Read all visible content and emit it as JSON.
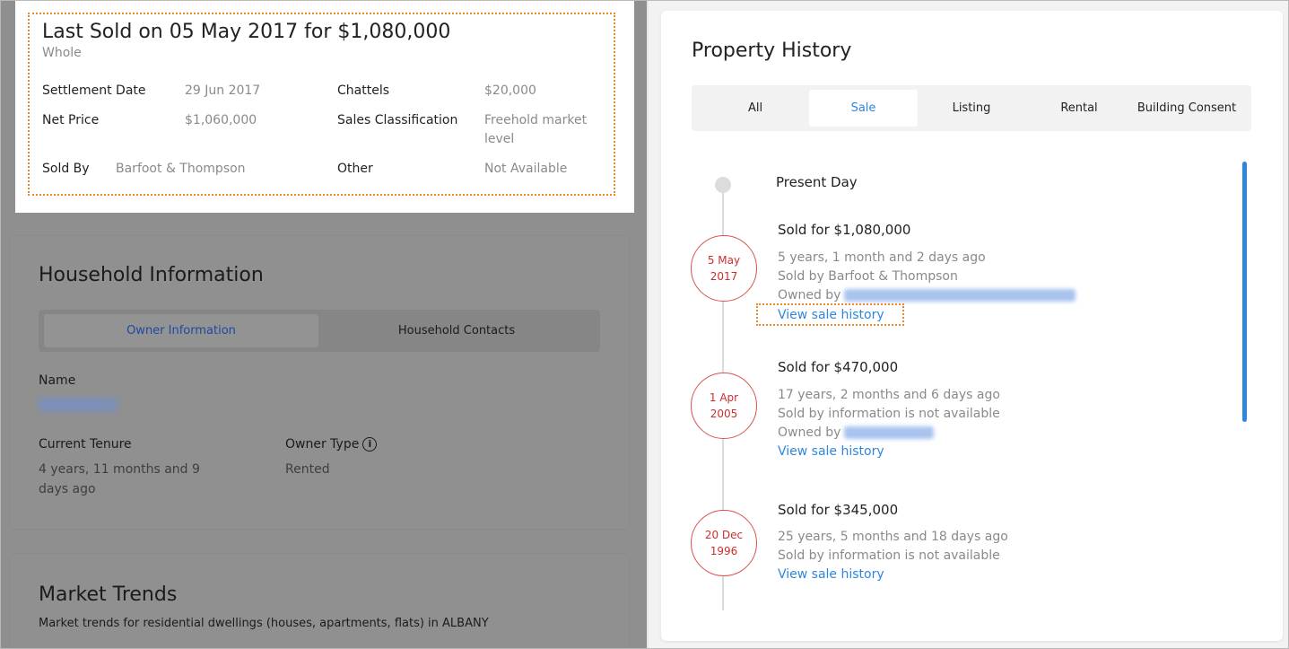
{
  "last_sold": {
    "title": "Last Sold on 05 May 2017 for $1,080,000",
    "subtitle": "Whole",
    "settlement_date_label": "Settlement Date",
    "settlement_date_value": "29 Jun 2017",
    "chattels_label": "Chattels",
    "chattels_value": "$20,000",
    "net_price_label": "Net Price",
    "net_price_value": "$1,060,000",
    "sales_class_label": "Sales Classification",
    "sales_class_value_1": "Freehold market",
    "sales_class_value_2": "level",
    "sold_by_label": "Sold By",
    "sold_by_value": "Barfoot & Thompson",
    "other_label": "Other",
    "other_value": "Not Available"
  },
  "household": {
    "title": "Household Information",
    "tab_owner": "Owner Information",
    "tab_contacts": "Household Contacts",
    "name_label": "Name",
    "tenure_label": "Current Tenure",
    "tenure_value_1": "4 years, 11 months and 9",
    "tenure_value_2": "days ago",
    "owner_type_label": "Owner Type",
    "owner_type_value": "Rented",
    "info_glyph": "i"
  },
  "market": {
    "title": "Market Trends",
    "subtitle": "Market trends for residential dwellings (houses, apartments, flats) in ALBANY"
  },
  "history": {
    "title": "Property History",
    "tabs": [
      "All",
      "Sale",
      "Listing",
      "Rental",
      "Building Consent"
    ],
    "active_tab": "Sale",
    "present_label": "Present Day",
    "sales": [
      {
        "date_line1": "5 May",
        "date_line2": "2017",
        "title": "Sold for $1,080,000",
        "ago": "5 years, 1 month and 2 days ago",
        "sold_by": "Sold by Barfoot & Thompson",
        "owned_by": "Owned by",
        "link": "View sale history"
      },
      {
        "date_line1": "1 Apr",
        "date_line2": "2005",
        "title": "Sold for $470,000",
        "ago": "17 years, 2 months and 6 days ago",
        "sold_by": "Sold by information is not available",
        "owned_by": "Owned by",
        "link": "View sale history"
      },
      {
        "date_line1": "20 Dec",
        "date_line2": "1996",
        "title": "Sold for $345,000",
        "ago": "25 years, 5 months and 18 days ago",
        "sold_by": "Sold by information is not available",
        "link": "View sale history"
      }
    ]
  },
  "colors": {
    "accent": "#2f86de",
    "highlight_border": "#e8892b",
    "date_red": "#d9534f",
    "overlay_gray": "#8f8f8f"
  }
}
